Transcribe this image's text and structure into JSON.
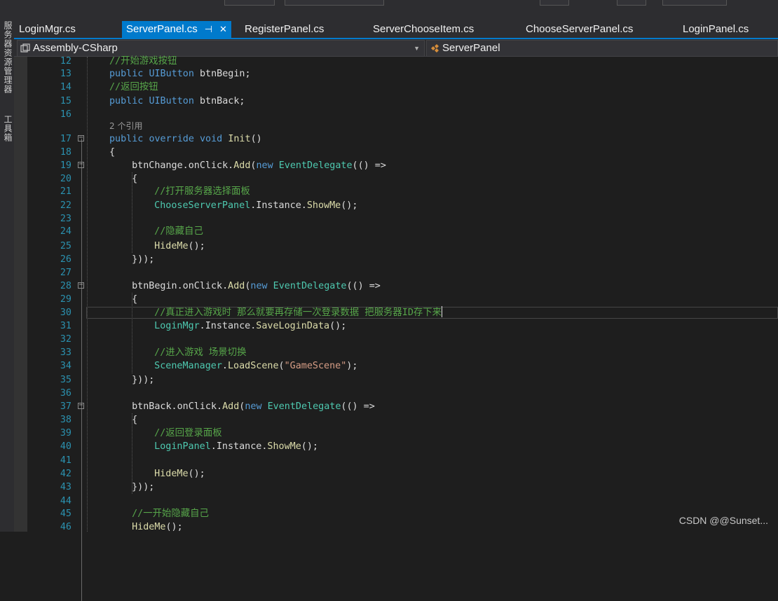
{
  "tabs": [
    {
      "label": "LoginMgr.cs",
      "active": false
    },
    {
      "label": "ServerPanel.cs",
      "active": true
    },
    {
      "label": "RegisterPanel.cs",
      "active": false
    },
    {
      "label": "ServerChooseItem.cs",
      "active": false
    },
    {
      "label": "ChooseServerPanel.cs",
      "active": false
    },
    {
      "label": "LoginPanel.cs",
      "active": false
    }
  ],
  "active_tab_icons": {
    "pin": "⊣",
    "close": "✕"
  },
  "side_dock": {
    "items": [
      "服务器资源管理器",
      "工具箱"
    ]
  },
  "nav": {
    "project": "Assembly-CSharp",
    "member": "ServerPanel"
  },
  "code_lens": "2 个引用",
  "code_lines": [
    {
      "n": "12",
      "tokens": [
        {
          "t": "//开始游戏按钮",
          "c": "cm"
        }
      ]
    },
    {
      "n": "13",
      "tokens": [
        {
          "t": "public ",
          "c": "kw"
        },
        {
          "t": "UIButton",
          "c": "kw"
        },
        {
          "t": " btnBegin;",
          "c": "pl"
        }
      ]
    },
    {
      "n": "14",
      "tokens": [
        {
          "t": "//返回按钮",
          "c": "cm"
        }
      ]
    },
    {
      "n": "15",
      "tokens": [
        {
          "t": "public ",
          "c": "kw"
        },
        {
          "t": "UIButton",
          "c": "kw"
        },
        {
          "t": " btnBack;",
          "c": "pl"
        }
      ]
    },
    {
      "n": "16",
      "tokens": []
    },
    {
      "n": "17",
      "tokens": [
        {
          "t": "public ",
          "c": "kw"
        },
        {
          "t": "override ",
          "c": "kw"
        },
        {
          "t": "void ",
          "c": "kw"
        },
        {
          "t": "Init",
          "c": "fn"
        },
        {
          "t": "()",
          "c": "pl"
        }
      ]
    },
    {
      "n": "18",
      "tokens": [
        {
          "t": "{",
          "c": "pl"
        }
      ]
    },
    {
      "n": "19",
      "tokens": [
        {
          "t": "btnChange.onClick.",
          "c": "pl"
        },
        {
          "t": "Add",
          "c": "fn"
        },
        {
          "t": "(",
          "c": "pl"
        },
        {
          "t": "new ",
          "c": "kw"
        },
        {
          "t": "EventDelegate",
          "c": "type"
        },
        {
          "t": "(() =>",
          "c": "pl"
        }
      ]
    },
    {
      "n": "20",
      "tokens": [
        {
          "t": "{",
          "c": "pl"
        }
      ]
    },
    {
      "n": "21",
      "tokens": [
        {
          "t": "//打开服务器选择面板",
          "c": "cm"
        }
      ]
    },
    {
      "n": "22",
      "tokens": [
        {
          "t": "ChooseServerPanel",
          "c": "type"
        },
        {
          "t": ".Instance.",
          "c": "pl"
        },
        {
          "t": "ShowMe",
          "c": "fn"
        },
        {
          "t": "();",
          "c": "pl"
        }
      ]
    },
    {
      "n": "23",
      "tokens": []
    },
    {
      "n": "24",
      "tokens": [
        {
          "t": "//隐藏自己",
          "c": "cm"
        }
      ]
    },
    {
      "n": "25",
      "tokens": [
        {
          "t": "HideMe",
          "c": "fn"
        },
        {
          "t": "();",
          "c": "pl"
        }
      ]
    },
    {
      "n": "26",
      "tokens": [
        {
          "t": "}));",
          "c": "pl"
        }
      ]
    },
    {
      "n": "27",
      "tokens": []
    },
    {
      "n": "28",
      "tokens": [
        {
          "t": "btnBegin.onClick.",
          "c": "pl"
        },
        {
          "t": "Add",
          "c": "fn"
        },
        {
          "t": "(",
          "c": "pl"
        },
        {
          "t": "new ",
          "c": "kw"
        },
        {
          "t": "EventDelegate",
          "c": "type"
        },
        {
          "t": "(() =>",
          "c": "pl"
        }
      ]
    },
    {
      "n": "29",
      "tokens": [
        {
          "t": "{",
          "c": "pl"
        }
      ]
    },
    {
      "n": "30",
      "tokens": [
        {
          "t": "//真正进入游戏时 那么就要再存储一次登录数据 把服务器ID存下来",
          "c": "cm"
        }
      ]
    },
    {
      "n": "31",
      "tokens": [
        {
          "t": "LoginMgr",
          "c": "type"
        },
        {
          "t": ".Instance.",
          "c": "pl"
        },
        {
          "t": "SaveLoginData",
          "c": "fn"
        },
        {
          "t": "();",
          "c": "pl"
        }
      ]
    },
    {
      "n": "32",
      "tokens": []
    },
    {
      "n": "33",
      "tokens": [
        {
          "t": "//进入游戏 场景切换",
          "c": "cm"
        }
      ]
    },
    {
      "n": "34",
      "tokens": [
        {
          "t": "SceneManager",
          "c": "type"
        },
        {
          "t": ".",
          "c": "pl"
        },
        {
          "t": "LoadScene",
          "c": "fn"
        },
        {
          "t": "(",
          "c": "pl"
        },
        {
          "t": "\"GameScene\"",
          "c": "str"
        },
        {
          "t": ");",
          "c": "pl"
        }
      ]
    },
    {
      "n": "35",
      "tokens": [
        {
          "t": "}));",
          "c": "pl"
        }
      ]
    },
    {
      "n": "36",
      "tokens": []
    },
    {
      "n": "37",
      "tokens": [
        {
          "t": "btnBack.onClick.",
          "c": "pl"
        },
        {
          "t": "Add",
          "c": "fn"
        },
        {
          "t": "(",
          "c": "pl"
        },
        {
          "t": "new ",
          "c": "kw"
        },
        {
          "t": "EventDelegate",
          "c": "type"
        },
        {
          "t": "(() =>",
          "c": "pl"
        }
      ]
    },
    {
      "n": "38",
      "tokens": [
        {
          "t": "{",
          "c": "pl"
        }
      ]
    },
    {
      "n": "39",
      "tokens": [
        {
          "t": "//返回登录面板",
          "c": "cm"
        }
      ]
    },
    {
      "n": "40",
      "tokens": [
        {
          "t": "LoginPanel",
          "c": "type"
        },
        {
          "t": ".Instance.",
          "c": "pl"
        },
        {
          "t": "ShowMe",
          "c": "fn"
        },
        {
          "t": "();",
          "c": "pl"
        }
      ]
    },
    {
      "n": "41",
      "tokens": []
    },
    {
      "n": "42",
      "tokens": [
        {
          "t": "HideMe",
          "c": "fn"
        },
        {
          "t": "();",
          "c": "pl"
        }
      ]
    },
    {
      "n": "43",
      "tokens": [
        {
          "t": "}));",
          "c": "pl"
        }
      ]
    },
    {
      "n": "44",
      "tokens": []
    },
    {
      "n": "45",
      "tokens": [
        {
          "t": "//一开始隐藏自己",
          "c": "cm"
        }
      ]
    },
    {
      "n": "46",
      "tokens": [
        {
          "t": "HideMe",
          "c": "fn"
        },
        {
          "t": "();",
          "c": "pl"
        }
      ]
    }
  ],
  "watermark": "CSDN @@Sunset...",
  "colors": {
    "accent": "#007acc",
    "keyword": "#569cd6",
    "type": "#4ec9b0",
    "comment": "#57a64a",
    "string": "#d69d85",
    "method": "#dcdcaa",
    "line_number": "#2b91af"
  }
}
